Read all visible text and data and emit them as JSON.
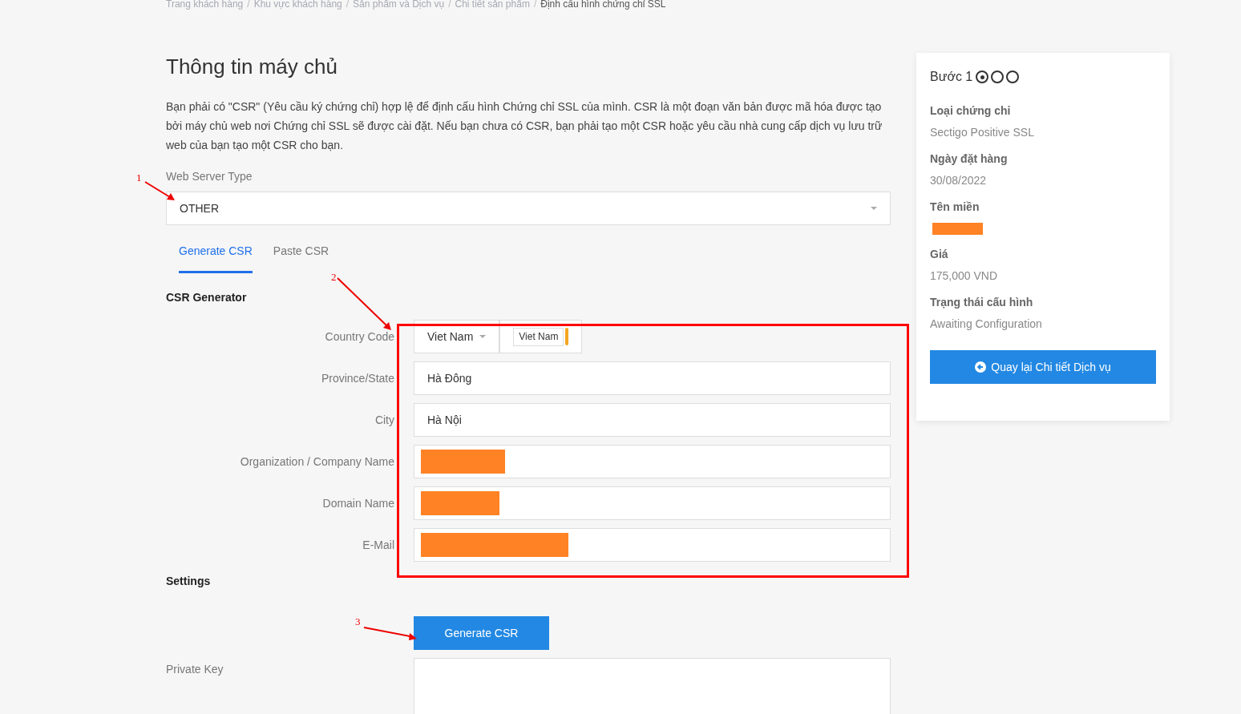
{
  "breadcrumb": [
    {
      "label": "Trang khách hàng",
      "current": false
    },
    {
      "label": "Khu vực khách hàng",
      "current": false
    },
    {
      "label": "Sản phẩm và Dịch vụ",
      "current": false
    },
    {
      "label": "Chi tiết sản phẩm",
      "current": false
    },
    {
      "label": "Định cấu hình chứng chỉ SSL",
      "current": true
    }
  ],
  "breadcrumb_separator": "/",
  "title": "Thông tin máy chủ",
  "intro": "Bạn phải có \"CSR\" (Yêu cầu ký chứng chỉ) hợp lệ để định cấu hình Chứng chỉ SSL của mình. CSR là một đoạn văn bản được mã hóa được tạo bởi máy chủ web nơi Chứng chỉ SSL sẽ được cài đặt. Nếu bạn chưa có CSR, bạn phải tạo một CSR hoặc yêu cầu nhà cung cấp dịch vụ lưu trữ web của bạn tạo một CSR cho bạn.",
  "web_server_type": {
    "label": "Web Server Type",
    "value": "OTHER"
  },
  "tabs": [
    {
      "label": "Generate CSR",
      "selected": true
    },
    {
      "label": "Paste CSR",
      "selected": false
    }
  ],
  "csr_generator": {
    "heading": "CSR Generator",
    "fields": [
      {
        "label": "Country Code",
        "kind": "country",
        "value": "Viet Nam",
        "search_value": "Viet Nam"
      },
      {
        "label": "Province/State",
        "kind": "text",
        "value": "Hà Đông"
      },
      {
        "label": "City",
        "kind": "text",
        "value": "Hà Nội"
      },
      {
        "label": "Organization / Company Name",
        "kind": "redacted"
      },
      {
        "label": "Domain Name",
        "kind": "redacted"
      },
      {
        "label": "E-Mail",
        "kind": "redacted"
      }
    ]
  },
  "settings": {
    "heading": "Settings",
    "button": "Generate CSR"
  },
  "private_key": {
    "label": "Private Key"
  },
  "annotations": [
    "1",
    "2",
    "3"
  ],
  "sidebar": {
    "step_label": "Bước 1",
    "steps": [
      {
        "selected": true
      },
      {
        "selected": false
      },
      {
        "selected": false
      }
    ],
    "details": [
      {
        "label": "Loại chứng chỉ",
        "kind": "text",
        "value": "Sectigo Positive SSL"
      },
      {
        "label": "Ngày đặt hàng",
        "kind": "text",
        "value": "30/08/2022"
      },
      {
        "label": "Tên miền",
        "kind": "redacted"
      },
      {
        "label": "Giá",
        "kind": "text",
        "value": "175,000 VND"
      },
      {
        "label": "Trạng thái cấu hình",
        "kind": "text",
        "value": "Awaiting Configuration"
      }
    ],
    "back_button": "Quay lại Chi tiết Dịch vụ"
  }
}
